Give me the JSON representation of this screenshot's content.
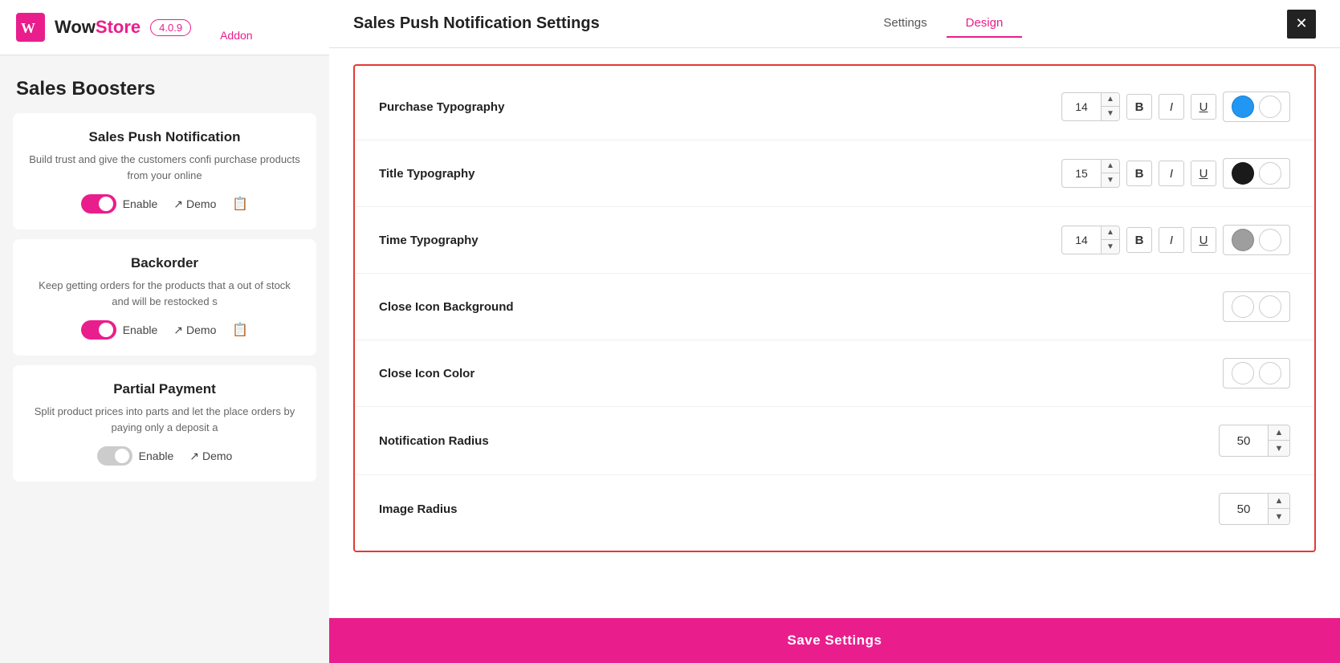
{
  "app": {
    "logo_w": "Wow",
    "logo_store": "Store",
    "version": "4.0.9",
    "addon_label": "Addon"
  },
  "sidebar": {
    "title": "Sales Boosters",
    "cards": [
      {
        "title": "Sales Push Notification",
        "desc": "Build trust and give the customers confi purchase products from your online",
        "enable_label": "Enable",
        "demo_label": "Demo",
        "enabled": true
      },
      {
        "title": "Backorder",
        "desc": "Keep getting orders for the products that a out of stock and will be restocked s",
        "enable_label": "Enable",
        "demo_label": "Demo",
        "enabled": true
      },
      {
        "title": "Partial Payment",
        "desc": "Split product prices into parts and let the place orders by paying only a deposit a",
        "enable_label": "Enable",
        "demo_label": "Demo",
        "enabled": false
      }
    ]
  },
  "modal": {
    "title": "Sales Push Notification Settings",
    "tabs": [
      "Settings",
      "Design"
    ],
    "active_tab": "Design",
    "close_label": "✕",
    "settings": [
      {
        "id": "purchase-typography",
        "label": "Purchase Typography",
        "font_size": "14",
        "bold": true,
        "italic": false,
        "underline": false,
        "color": "#2196F3",
        "color_secondary": "#ffffff"
      },
      {
        "id": "title-typography",
        "label": "Title Typography",
        "font_size": "15",
        "bold": false,
        "italic": false,
        "underline": false,
        "color": "#1a1a1a",
        "color_secondary": "#ffffff"
      },
      {
        "id": "time-typography",
        "label": "Time Typography",
        "font_size": "14",
        "bold": false,
        "italic": false,
        "underline": false,
        "color": "#9e9e9e",
        "color_secondary": "#ffffff"
      },
      {
        "id": "close-icon-background",
        "label": "Close Icon Background",
        "type": "color-only",
        "color": "#ffffff",
        "color_secondary": "#ffffff"
      },
      {
        "id": "close-icon-color",
        "label": "Close Icon Color",
        "type": "color-only",
        "color": "#ffffff",
        "color_secondary": "#ffffff"
      },
      {
        "id": "notification-radius",
        "label": "Notification Radius",
        "type": "radius",
        "value": "50"
      },
      {
        "id": "image-radius",
        "label": "Image Radius",
        "type": "radius",
        "value": "50"
      }
    ],
    "save_label": "Save Settings"
  },
  "colors": {
    "accent": "#e91e8c",
    "danger": "#e53935"
  }
}
